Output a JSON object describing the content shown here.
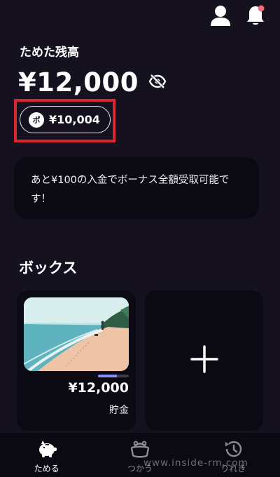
{
  "header": {
    "icons": [
      "user-icon",
      "bell-icon"
    ],
    "notification_dot_color": "#f26b7a"
  },
  "balance": {
    "label": "ためた残高",
    "amount": "¥12,000"
  },
  "points": {
    "badge": "ポ",
    "amount": "¥10,004"
  },
  "notice": {
    "text": "あと¥100の入金でボーナス全額受取可能です！"
  },
  "boxes": {
    "title": "ボックス",
    "items": [
      {
        "amount": "¥12,000",
        "name": "貯金",
        "progress": 0.62
      }
    ]
  },
  "nav": {
    "items": [
      {
        "label": "ためる",
        "icon": "piggy-bank-icon",
        "active": true
      },
      {
        "label": "つかう",
        "icon": "wallet-icon",
        "active": false
      },
      {
        "label": "りれき",
        "icon": "history-icon",
        "active": false
      }
    ]
  },
  "watermark": "www.inside-rm.com",
  "colors": {
    "background": "#15111f",
    "card": "#0b0911",
    "highlight": "#d9262f",
    "progress": "#8a8ff7"
  }
}
